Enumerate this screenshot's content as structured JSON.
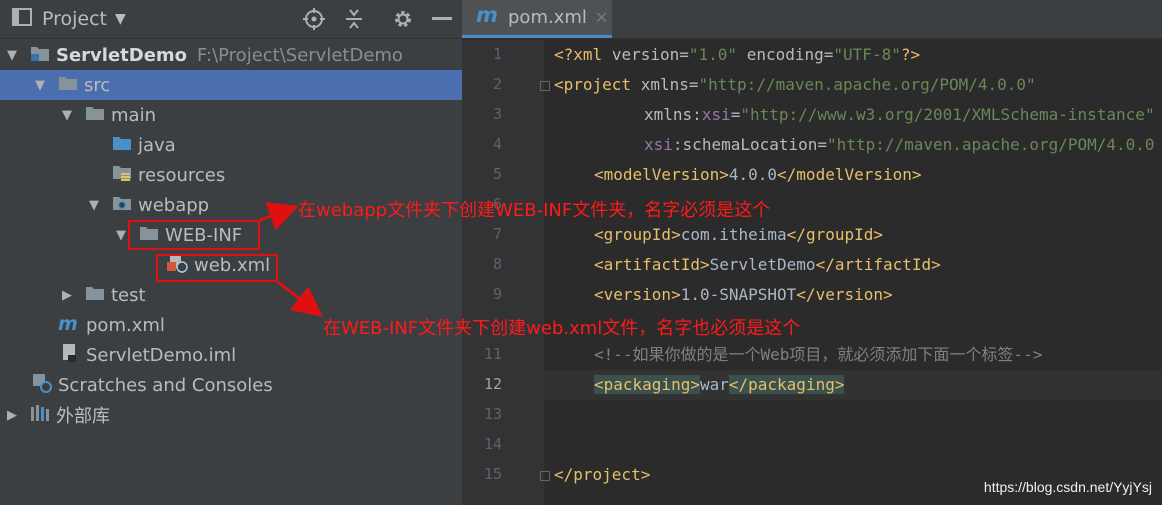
{
  "project_panel": {
    "title": "Project",
    "tree": [
      {
        "label": "ServletDemo",
        "path": "F:\\Project\\ServletDemo"
      },
      {
        "label": "src"
      },
      {
        "label": "main"
      },
      {
        "label": "java"
      },
      {
        "label": "resources"
      },
      {
        "label": "webapp"
      },
      {
        "label": "WEB-INF"
      },
      {
        "label": "web.xml"
      },
      {
        "label": "test"
      },
      {
        "label": "pom.xml"
      },
      {
        "label": "ServletDemo.iml"
      },
      {
        "label": "Scratches and Consoles"
      },
      {
        "label": "外部库"
      }
    ]
  },
  "editor": {
    "tab_label": "pom.xml",
    "current_line": 12,
    "line_numbers": [
      "1",
      "2",
      "3",
      "4",
      "5",
      "6",
      "7",
      "8",
      "9",
      "10",
      "11",
      "12",
      "13",
      "14",
      "15"
    ]
  },
  "annotations": {
    "webinf_note": "在webapp文件夹下创建WEB-INF文件夹，名字必须是这个",
    "webxml_note": "在WEB-INF文件夹下创建web.xml文件，名字也必须是这个"
  },
  "watermark": "https://blog.csdn.net/YyjYsj",
  "colors": {
    "selection": "#4b6eaf",
    "annotation": "#e01010"
  }
}
